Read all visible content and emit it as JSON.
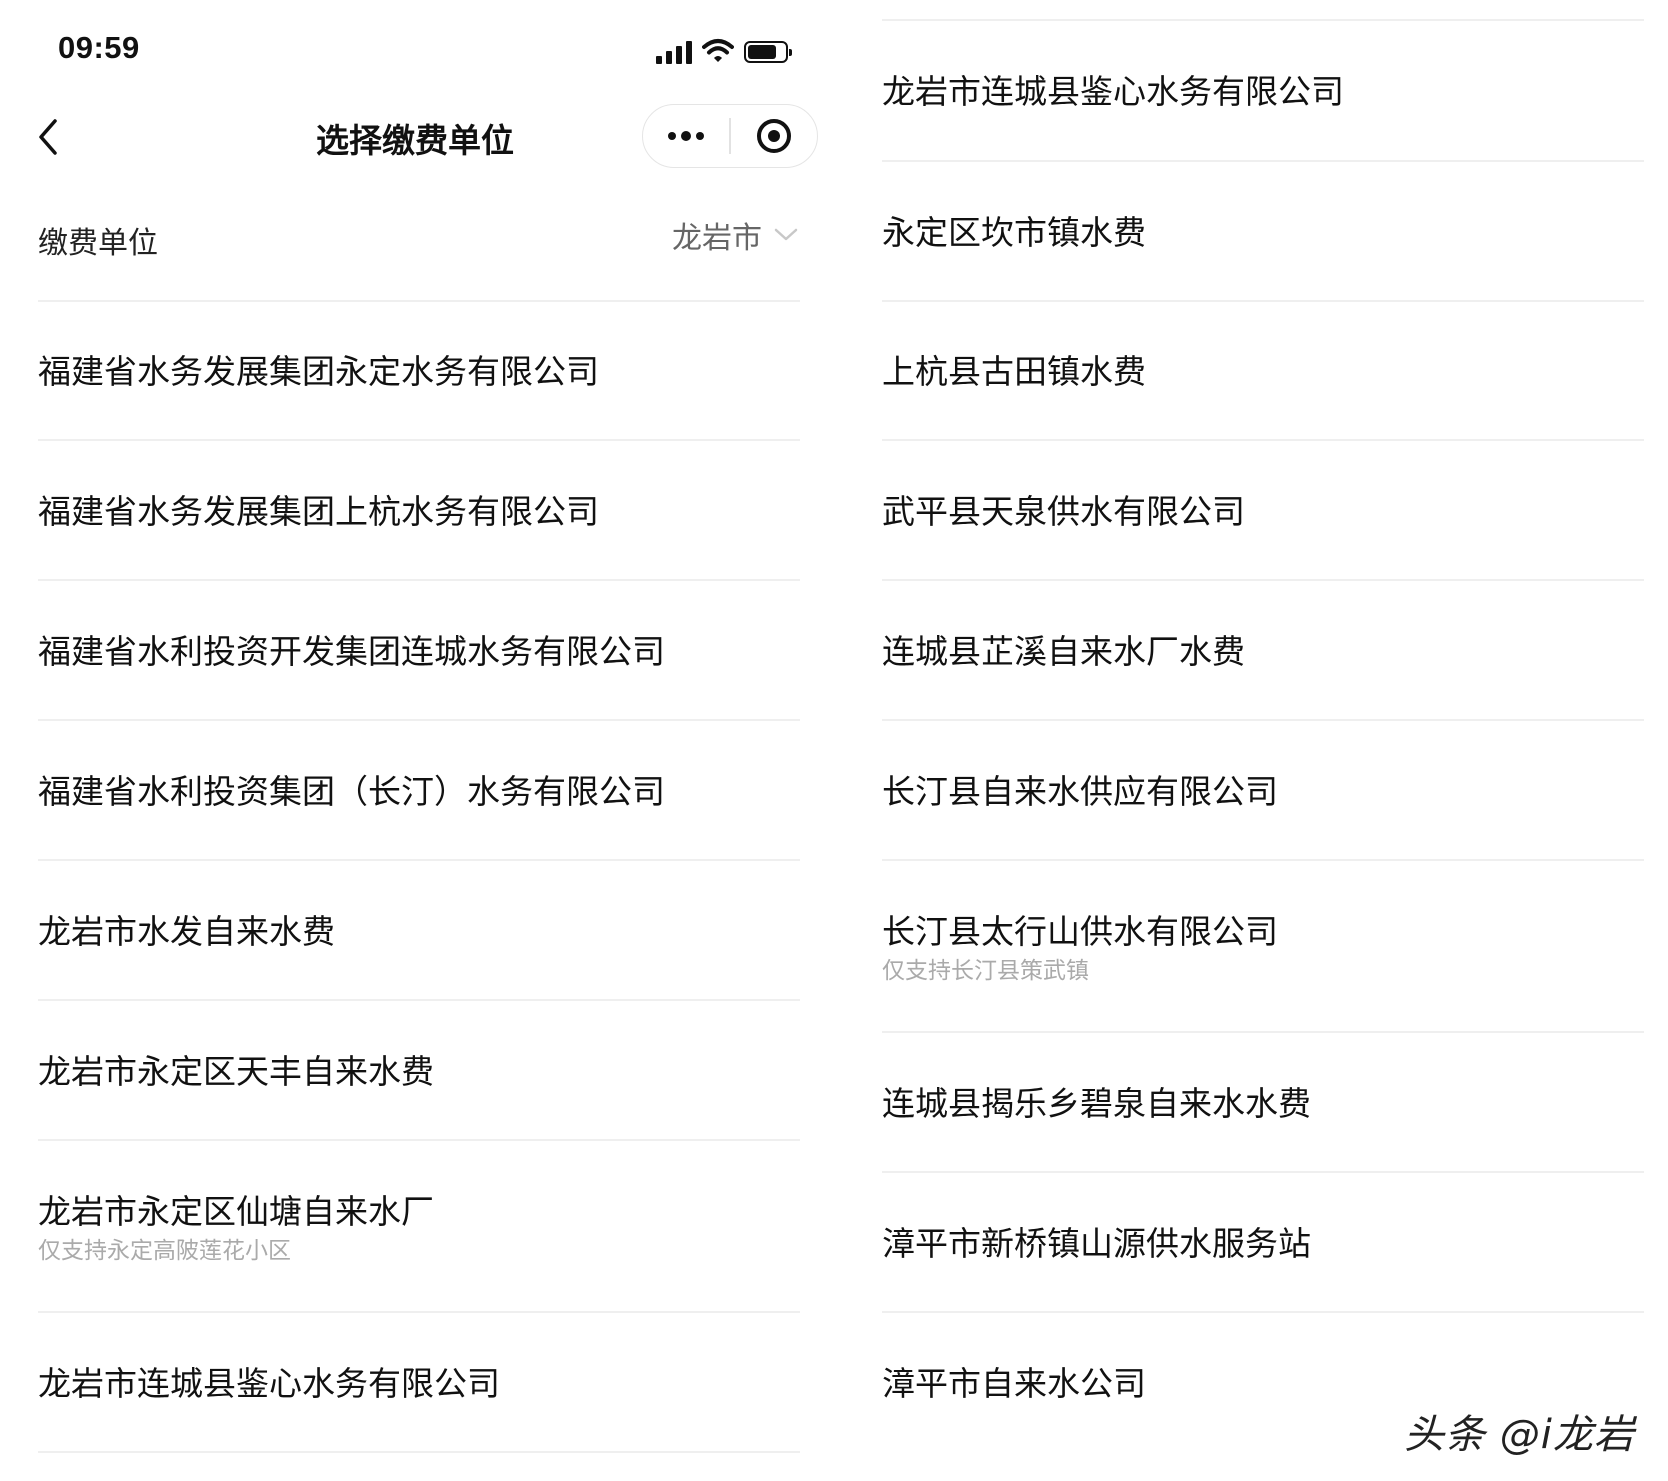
{
  "status_bar": {
    "time": "09:59",
    "icons": [
      "signal-icon",
      "wifi-icon",
      "battery-icon"
    ]
  },
  "nav": {
    "title": "选择缴费单位",
    "back_icon": "chevron-left-icon",
    "more_icon": "more-dots-icon",
    "close_icon": "target-circle-icon"
  },
  "filter": {
    "label": "缴费单位",
    "region_value": "龙岩市",
    "dropdown_icon": "chevron-down-icon"
  },
  "left_list": [
    {
      "name": "福建省水务发展集团永定水务有限公司"
    },
    {
      "name": "福建省水务发展集团上杭水务有限公司"
    },
    {
      "name": "福建省水利投资开发集团连城水务有限公司"
    },
    {
      "name": "福建省水利投资集团（长汀）水务有限公司"
    },
    {
      "name": "龙岩市水发自来水费"
    },
    {
      "name": "龙岩市永定区天丰自来水费"
    },
    {
      "name": "龙岩市永定区仙塘自来水厂",
      "note": "仅支持永定高陂莲花小区"
    },
    {
      "name": "龙岩市连城县鉴心水务有限公司"
    }
  ],
  "right_list": [
    {
      "name": "龙岩市连城县鉴心水务有限公司"
    },
    {
      "name": "永定区坎市镇水费"
    },
    {
      "name": "上杭县古田镇水费"
    },
    {
      "name": "武平县天泉供水有限公司"
    },
    {
      "name": "连城县芷溪自来水厂水费"
    },
    {
      "name": "长汀县自来水供应有限公司"
    },
    {
      "name": "长汀县太行山供水有限公司",
      "note": "仅支持长汀县策武镇"
    },
    {
      "name": "连城县揭乐乡碧泉自来水水费"
    },
    {
      "name": "漳平市新桥镇山源供水服务站"
    },
    {
      "name": "漳平市自来水公司"
    }
  ],
  "watermark": "头条 @i龙岩"
}
